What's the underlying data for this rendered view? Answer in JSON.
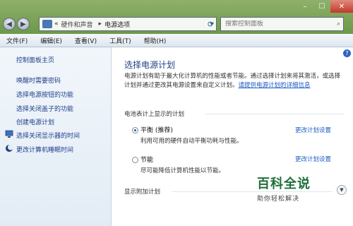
{
  "window": {
    "address": {
      "part1": "硬件和声音",
      "part2": "电源选项",
      "chevrons": "«",
      "arrow": "▸"
    },
    "search_placeholder": "搜索控制面板",
    "controls": {
      "minimize": "–",
      "maximize": "☐",
      "close": "✕"
    }
  },
  "menu": [
    "文件(F)",
    "编辑(E)",
    "查看(V)",
    "工具(T)",
    "帮助(H)"
  ],
  "sidebar": {
    "home": "控制面板主页",
    "items": [
      {
        "label": "唤醒时需要密码"
      },
      {
        "label": "选择电源按钮的功能"
      },
      {
        "label": "选择关闭盖子的功能"
      },
      {
        "label": "创建电源计划"
      },
      {
        "label": "选择关闭显示器的时间",
        "icon": "monitor-icon"
      },
      {
        "label": "更改计算机睡眠时间",
        "icon": "moon-icon"
      }
    ]
  },
  "main": {
    "title": "选择电源计划",
    "description": "电源计划有助于最大化计算机的性能或者节能。通过选择计划来将其激活，或选择计划并通过更改其电源设置来自定义计划。",
    "learn_more": "请提供电源计划的详细信息",
    "battery_section": "电池表计上显示的计划",
    "plans": [
      {
        "name": "平衡 (推荐)",
        "desc": "利用可用的硬件自动平衡功耗与性能。",
        "link": "更改计划设置",
        "selected": true
      },
      {
        "name": "节能",
        "desc": "尽可能降低计算机性能以节能。",
        "link": "更改计划设置",
        "selected": false
      }
    ],
    "additional_section": "显示附加计划"
  },
  "watermark": {
    "title": "百科全说",
    "subtitle": "助你轻松解决"
  }
}
